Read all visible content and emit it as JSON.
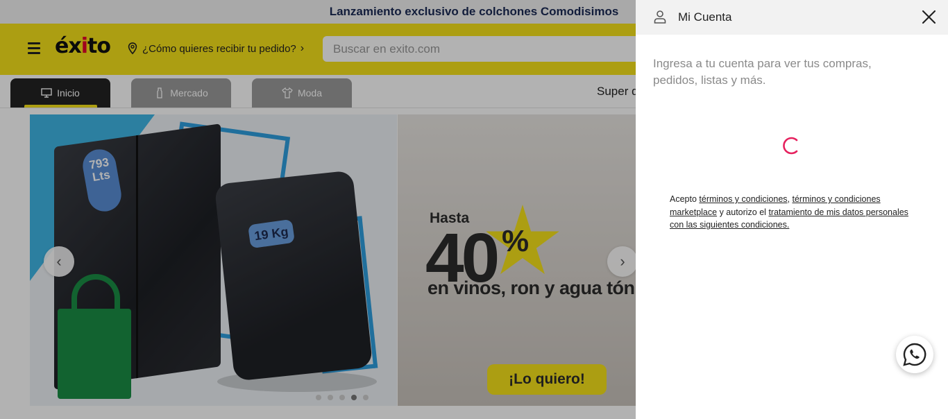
{
  "promo_bar": {
    "text": "Lanzamiento exclusivo de colchones Comodisimos"
  },
  "header": {
    "logo": "éxito",
    "delivery_text": "¿Cómo quieres recibir tu pedido?",
    "search_placeholder": "Buscar en exito.com"
  },
  "tabs": [
    {
      "label": "Inicio",
      "icon": "monitor-icon",
      "active": true
    },
    {
      "label": "Mercado",
      "icon": "bottle-icon",
      "active": false
    },
    {
      "label": "Moda",
      "icon": "shirt-icon",
      "active": false
    }
  ],
  "tab_overflow": "Super d",
  "banner1": {
    "fridge_badge": "793 Lts",
    "washer_badge": "19 Kg"
  },
  "banner2": {
    "hasta": "Hasta",
    "big_number": "40",
    "percent": "%",
    "subtitle": "en vinos, ron y agua tóni",
    "cta": "¡Lo quiero!"
  },
  "carousel": {
    "dots": 5,
    "active_dot": 3
  },
  "panel": {
    "title": "Mi Cuenta",
    "description": "Ingresa a tu cuenta para ver tus compras, pedidos, listas y más.",
    "legal": {
      "prefix": "Acepto ",
      "link1": "términos y condiciones",
      "sep": ", ",
      "link2": "términos y condiciones marketplace",
      "middle": " y autorizo el ",
      "link3": "tratamiento de mis datos personales con las siguientes condiciones."
    }
  },
  "colors": {
    "brand_yellow": "#f7e21a",
    "spinner": "#e6215e",
    "whatsapp": "#25d366"
  }
}
